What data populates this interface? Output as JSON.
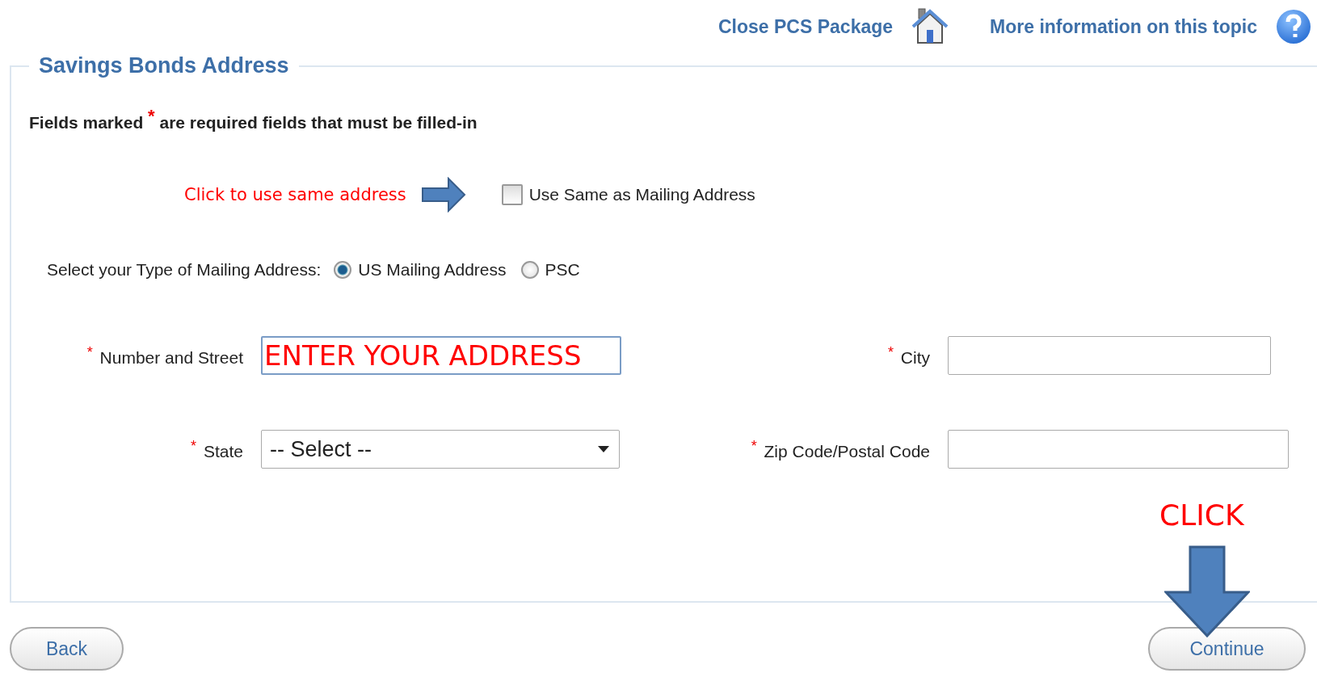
{
  "header_links": [
    {
      "label": "Close PCS Package"
    },
    {
      "label": "More information on this topic"
    }
  ],
  "section": {
    "title": "Savings Bonds Address"
  },
  "required_note": "Fields marked $^{*}$ are required fields that must be filled-in",
  "same_address": {
    "label": "Use Same as Mailing Address",
    "checked": false
  },
  "address_type": {
    "label": "Select your Type of Mailing Address:",
    "options": [
      {
        "label": "US Mailing Address",
        "selected": true
      },
      {
        "label": "PSC",
        "selected": false
      }
    ]
  },
  "fields": [
    {
      "kind": "text",
      "label": "Number and Street",
      "required_mark": "*",
      "value": "ENTER YOUR ADDRESS"
    },
    {
      "kind": "text",
      "label": "City",
      "required_mark": "*"
    },
    {
      "kind": "select",
      "label": "State",
      "required_mark": "*",
      "value": "-- Select --"
    },
    {
      "kind": "text",
      "label": "Zip Code/Postal Code",
      "required_mark": "*"
    }
  ],
  "buttons": [
    {
      "label": "Back"
    },
    {
      "label": "Continue"
    }
  ],
  "annotations": [
    {
      "kind": "arrow_right",
      "text": "Click to use same address"
    },
    {
      "kind": "arrow_down",
      "text": "CLICK"
    }
  ]
}
